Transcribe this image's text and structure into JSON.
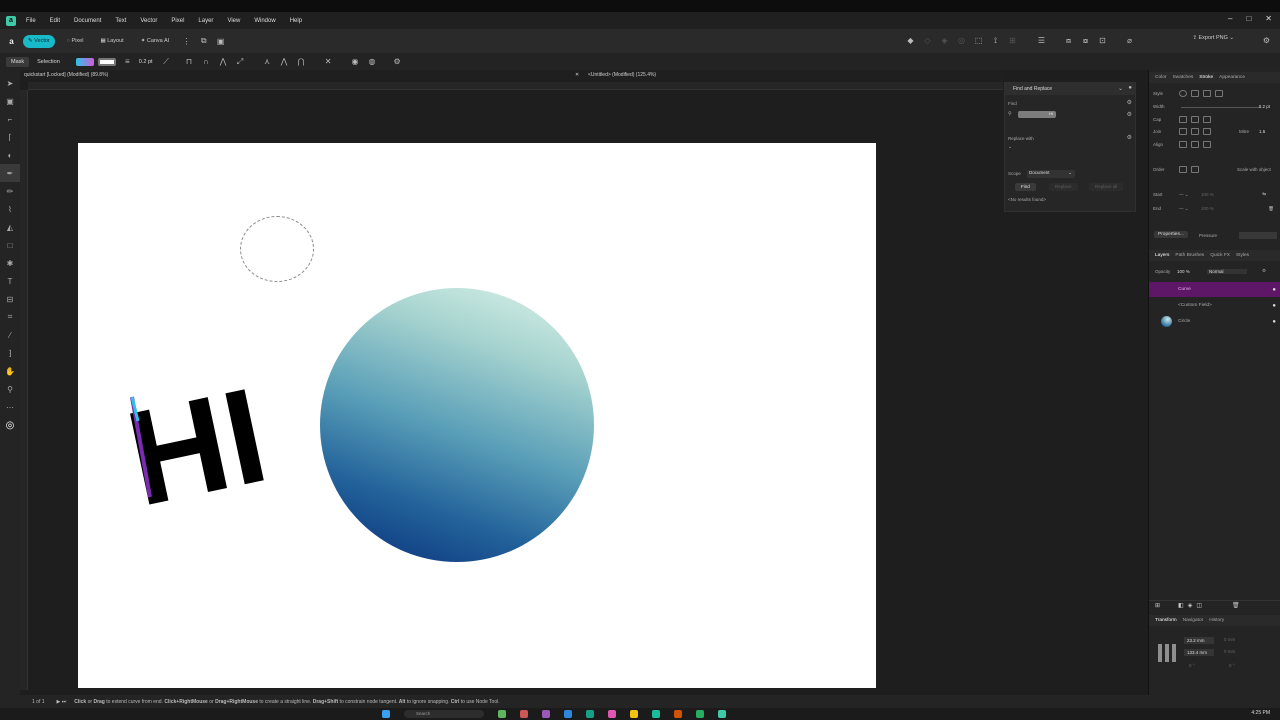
{
  "app": {
    "logo_letter": "a",
    "menus": [
      "File",
      "Edit",
      "Document",
      "Text",
      "Vector",
      "Pixel",
      "Layer",
      "View",
      "Window",
      "Help"
    ]
  },
  "toolbar": {
    "personas": [
      "Vector",
      "Pixel",
      "Layout",
      "Canva AI"
    ],
    "export_label": "Export PNG"
  },
  "context_bar": {
    "mask_label": "Mask",
    "selection_label": "Selection",
    "stroke_width": "0.2 pt"
  },
  "tabs": [
    {
      "label": "quickstart [Locked] (Modified) (89.8%)"
    },
    {
      "label": "<Untitled> (Modified) (125.4%)"
    }
  ],
  "canvas": {
    "text": "HI"
  },
  "find_replace": {
    "title": "Find and Replace",
    "find_label": "Find",
    "find_value": "HI",
    "replace_label": "Replace with",
    "scope_label": "Scope",
    "scope_value": "Document",
    "find_btn": "Find",
    "replace_btn": "Replace",
    "replace_all_btn": "Replace all",
    "result_text": "<No results found>"
  },
  "right_dock": {
    "top_tabs": [
      "Color",
      "Swatches",
      "Stroke",
      "Appearance"
    ],
    "style_label": "Style",
    "width_label": "Width",
    "width_value": "0.2 pt",
    "cap_label": "Cap",
    "join_label": "Join",
    "mitre_label": "Mitre",
    "mitre_value": "1.5",
    "align_label": "Align",
    "order_label": "Order",
    "scale_label": "Scale with object",
    "start_label": "Start",
    "end_label": "End",
    "start_pct": "100 %",
    "end_pct": "100 %",
    "properties_btn": "Properties...",
    "pressure_label": "Pressure",
    "layer_tabs": [
      "Layers",
      "Path Brushes",
      "Quick FX",
      "Styles"
    ],
    "opacity_label": "Opacity",
    "opacity_value": "100 %",
    "blend_value": "Normal",
    "layers": [
      {
        "name": "Curve",
        "selected": true
      },
      {
        "name": "<Custom Field>",
        "selected": false
      },
      {
        "name": "Circle",
        "selected": false
      }
    ],
    "bottom_tabs": [
      "Transform",
      "Navigator",
      "History"
    ],
    "x_value": "23.2 mm",
    "y_value": "133.4 mm",
    "w_value": "0 mm",
    "h_value": "0 mm",
    "r_value": "0 °",
    "s_value": "0 °"
  },
  "status": {
    "page": "1 of 1",
    "hint_parts": [
      {
        "b": "Click",
        "t": " or "
      },
      {
        "b": "Drag",
        "t": " to extend curve from end. "
      },
      {
        "b": "Click+RightMouse",
        "t": " or "
      },
      {
        "b": "Drag+RightMouse",
        "t": " to create a straight line. "
      },
      {
        "b": "Drag+Shift",
        "t": " to constrain node tangent. "
      },
      {
        "b": "Alt",
        "t": " to ignore snapping. "
      },
      {
        "b": "Ctrl",
        "t": " to use Node Tool."
      }
    ]
  },
  "taskbar": {
    "search_label": "Search",
    "time": "4:25 PM"
  },
  "colors": {
    "accent": "#18b9c8",
    "layer_selected": "#5d1766",
    "canvas": "#ffffff"
  }
}
